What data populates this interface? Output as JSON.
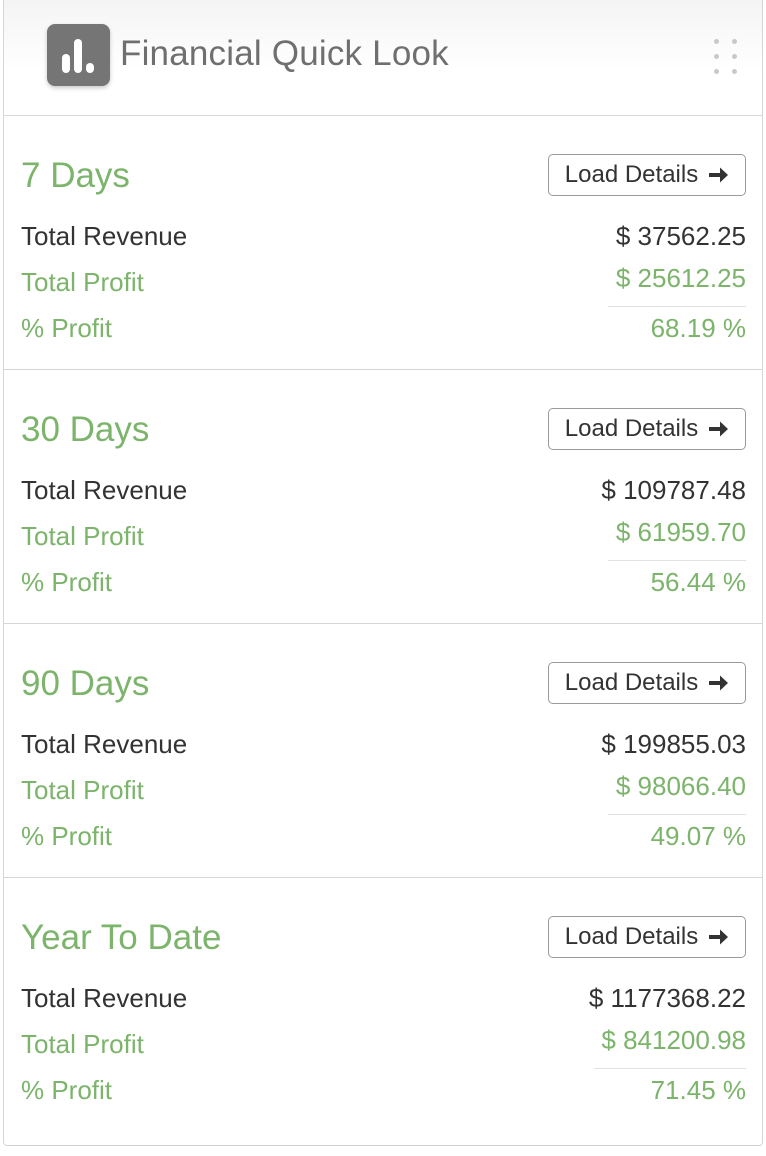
{
  "header": {
    "title": "Financial Quick Look",
    "logo_icon": "bar-chart-icon",
    "menu_icon": "drag-grip-icon"
  },
  "colors": {
    "accent_green": "#7cb46b",
    "text_dark": "#333333",
    "logo_bg": "#757575"
  },
  "sections": [
    {
      "period": "7 Days",
      "button_label": "Load Details",
      "revenue_label": "Total Revenue",
      "revenue_value": "$ 37562.25",
      "profit_label": "Total Profit",
      "profit_value": "$ 25612.25",
      "percent_label": "% Profit",
      "percent_value": "68.19 %"
    },
    {
      "period": "30 Days",
      "button_label": "Load Details",
      "revenue_label": "Total Revenue",
      "revenue_value": "$ 109787.48",
      "profit_label": "Total Profit",
      "profit_value": "$ 61959.70",
      "percent_label": "% Profit",
      "percent_value": "56.44 %"
    },
    {
      "period": "90 Days",
      "button_label": "Load Details",
      "revenue_label": "Total Revenue",
      "revenue_value": "$ 199855.03",
      "profit_label": "Total Profit",
      "profit_value": "$ 98066.40",
      "percent_label": "% Profit",
      "percent_value": "49.07 %"
    },
    {
      "period": "Year To Date",
      "button_label": "Load Details",
      "revenue_label": "Total Revenue",
      "revenue_value": "$ 1177368.22",
      "profit_label": "Total Profit",
      "profit_value": "$ 841200.98",
      "percent_label": "% Profit",
      "percent_value": "71.45 %"
    }
  ]
}
